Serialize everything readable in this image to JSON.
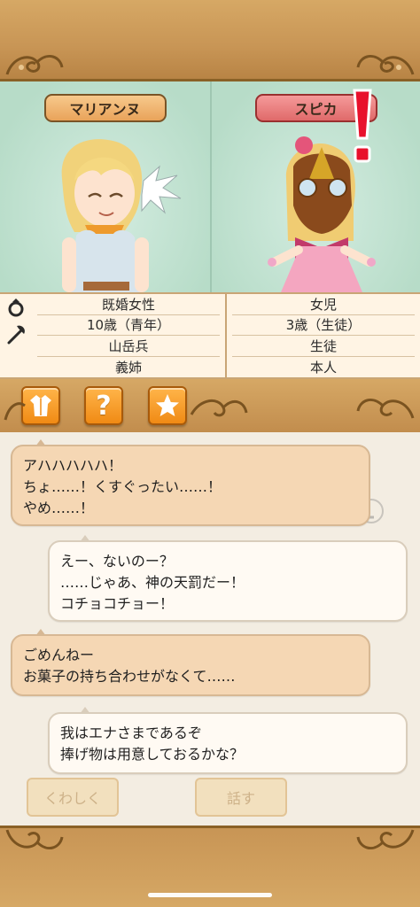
{
  "characters": {
    "left": {
      "name": "マリアンヌ",
      "info": [
        "既婚女性",
        "10歳（青年）",
        "山岳兵",
        "義姉"
      ]
    },
    "right": {
      "name": "スピカ",
      "info": [
        "女児",
        "3歳（生徒）",
        "生徒",
        "本人"
      ]
    }
  },
  "action_icons": [
    "dress-icon",
    "question-icon",
    "star-icon"
  ],
  "question_glyph": "?",
  "chat": [
    {
      "side": "left",
      "lines": [
        "アハハハハハ！",
        "ちょ……！くすぐったい……！",
        "やめ……！"
      ]
    },
    {
      "side": "right",
      "lines": [
        "えー、ないのー？",
        "……じゃあ、神の天罰だー！",
        "コチョコチョー！"
      ]
    },
    {
      "side": "left",
      "lines": [
        "ごめんねー",
        "お菓子の持ち合わせがなくて……"
      ]
    },
    {
      "side": "right",
      "lines": [
        "我はエナさまであるぞ",
        "捧げ物は用意しておるかな？"
      ]
    }
  ],
  "background_buttons": {
    "details": "くわしく",
    "talk": "話す"
  },
  "colors": {
    "band": "#c89555",
    "panel": "#bfe0d0",
    "bubble_left": "#f5d7b4",
    "bubble_right": "#fffaf3",
    "button_orange": "#f08a14",
    "name_plate_left": "#e9a35a",
    "name_plate_right": "#e06a6a"
  }
}
